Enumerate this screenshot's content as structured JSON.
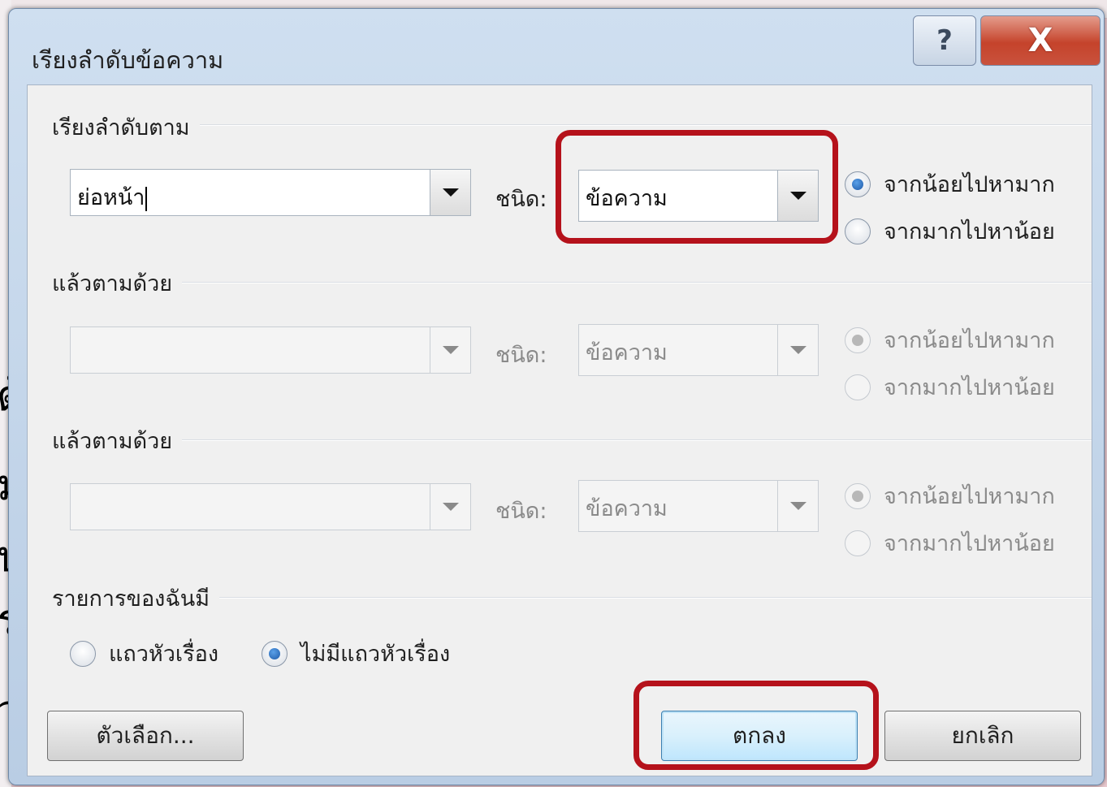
{
  "background": {
    "left_text": [
      "ด้",
      "ม",
      "ป",
      "ร",
      "ว"
    ]
  },
  "dialog": {
    "title": "เรียงลำดับข้อความ",
    "help_label": "?",
    "close_label": "X",
    "sort_by": {
      "label": "เรียงลำดับตาม",
      "field_value": "ย่อหน้า",
      "type_label": "ชนิด:",
      "type_value": "ข้อความ",
      "ascending_label": "จากน้อยไปหามาก",
      "descending_label": "จากมากไปหาน้อย",
      "selected": "ascending"
    },
    "then_by_1": {
      "label": "แล้วตามด้วย",
      "field_value": "",
      "type_label": "ชนิด:",
      "type_value": "ข้อความ",
      "ascending_label": "จากน้อยไปหามาก",
      "descending_label": "จากมากไปหาน้อย",
      "enabled": false
    },
    "then_by_2": {
      "label": "แล้วตามด้วย",
      "field_value": "",
      "type_label": "ชนิด:",
      "type_value": "ข้อความ",
      "ascending_label": "จากน้อยไปหามาก",
      "descending_label": "จากมากไปหาน้อย",
      "enabled": false
    },
    "my_list_has": {
      "label": "รายการของฉันมี",
      "header_row_label": "แถวหัวเรื่อง",
      "no_header_row_label": "ไม่มีแถวหัวเรื่อง",
      "selected": "no_header_row"
    },
    "buttons": {
      "options": "ตัวเลือก...",
      "ok": "ตกลง",
      "cancel": "ยกเลิก"
    },
    "highlight_color": "#b5121b"
  }
}
